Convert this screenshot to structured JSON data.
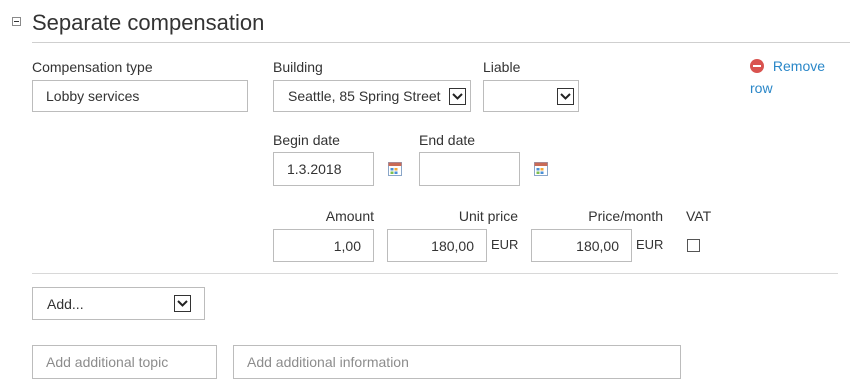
{
  "section": {
    "title": "Separate compensation"
  },
  "compensation_type": {
    "label": "Compensation type",
    "value": "Lobby services"
  },
  "building": {
    "label": "Building",
    "value": "Seattle, 85 Spring Street"
  },
  "liable": {
    "label": "Liable",
    "value": ""
  },
  "remove_row": {
    "line1": "Remove",
    "line2": "row"
  },
  "begin_date": {
    "label": "Begin date",
    "value": "1.3.2018"
  },
  "end_date": {
    "label": "End date",
    "value": ""
  },
  "amount": {
    "label": "Amount",
    "value": "1,00"
  },
  "unit_price": {
    "label": "Unit price",
    "value": "180,00",
    "currency": "EUR"
  },
  "price_month": {
    "label": "Price/month",
    "value": "180,00",
    "currency": "EUR"
  },
  "vat": {
    "label": "VAT",
    "checked": false
  },
  "add_select": {
    "value": "Add..."
  },
  "additional_topic": {
    "placeholder": "Add additional topic"
  },
  "additional_information": {
    "placeholder": "Add additional information"
  },
  "colors": {
    "link": "#2a87c8",
    "remove_icon": "#d9534f",
    "border": "#bcbcbc"
  }
}
